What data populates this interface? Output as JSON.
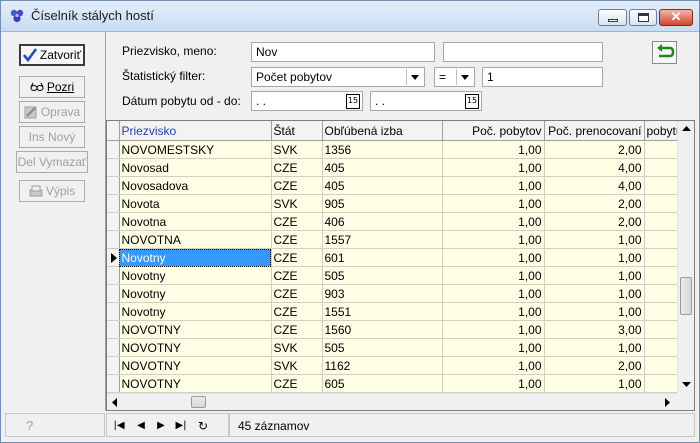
{
  "window": {
    "title": "Číselník stálych hostí"
  },
  "sidebar": {
    "close_label": "Zatvoriť",
    "view_label": "Pozri",
    "edit_label": "Oprava",
    "new_label": "Ins Nový",
    "delete_label": "Del Vymazať",
    "print_label": "Výpis"
  },
  "filters": {
    "name_label": "Priezvisko, meno:",
    "name_value": "Nov",
    "name_value2": "",
    "stat_label": "Štatistický filter:",
    "stat_value": "Počet pobytov",
    "operator": "=",
    "stat_number": "1",
    "date_label": "Dátum pobytu od - do:",
    "date_from": " .  .",
    "date_to": " .  ."
  },
  "grid": {
    "columns": [
      "Priezvisko",
      "Štát",
      "Obľúbená izba",
      "Poč. pobytov",
      "Poč. prenocovaní",
      "pobytu"
    ],
    "selected_index": 6,
    "rows": [
      [
        "NOVOMESTSKY",
        "SVK",
        "1356",
        "1,00",
        "2,00"
      ],
      [
        "Novosad",
        "CZE",
        "405",
        "1,00",
        "4,00"
      ],
      [
        "Novosadova",
        "CZE",
        "405",
        "1,00",
        "4,00"
      ],
      [
        "Novota",
        "SVK",
        "905",
        "1,00",
        "2,00"
      ],
      [
        "Novotna",
        "CZE",
        "406",
        "1,00",
        "2,00"
      ],
      [
        "NOVOTNA",
        "CZE",
        "1557",
        "1,00",
        "1,00"
      ],
      [
        "Novotny",
        "CZE",
        "601",
        "1,00",
        "1,00"
      ],
      [
        "Novotny",
        "CZE",
        "505",
        "1,00",
        "1,00"
      ],
      [
        "Novotny",
        "CZE",
        "903",
        "1,00",
        "1,00"
      ],
      [
        "Novotny",
        "CZE",
        "1551",
        "1,00",
        "1,00"
      ],
      [
        "NOVOTNY",
        "CZE",
        "1560",
        "1,00",
        "3,00"
      ],
      [
        "NOVOTNY",
        "SVK",
        "505",
        "1,00",
        "1,00"
      ],
      [
        "NOVOTNY",
        "SVK",
        "1162",
        "1,00",
        "2,00"
      ],
      [
        "NOVOTNY",
        "CZE",
        "605",
        "1,00",
        "1,00"
      ]
    ]
  },
  "status": {
    "help": "?",
    "count_text": "45 záznamov"
  },
  "colors": {
    "selection": "#3399ff",
    "row_bg": "#ffffe6",
    "accent_icon": "#2b7a2b"
  }
}
